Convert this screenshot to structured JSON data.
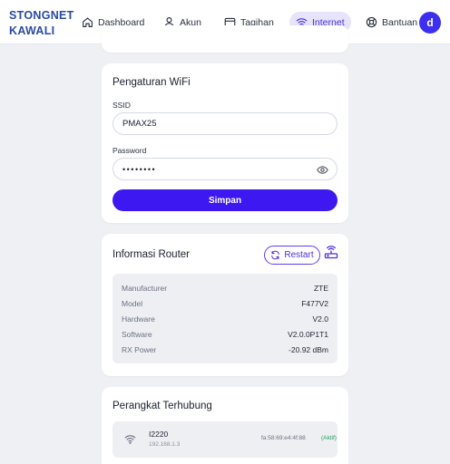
{
  "brand": {
    "line1": "STONGNET",
    "line2": "KAWALI"
  },
  "nav": [
    {
      "label": "Dashboard",
      "icon": "home-icon"
    },
    {
      "label": "Akun",
      "icon": "user-icon"
    },
    {
      "label": "Tagihan",
      "icon": "card-icon"
    },
    {
      "label": "Internet",
      "icon": "wifi-icon",
      "active": true
    },
    {
      "label": "Bantuan",
      "icon": "lifebuoy-icon"
    }
  ],
  "user": {
    "avatar_letter": "d"
  },
  "wifi_settings": {
    "title": "Pengaturan WiFi",
    "ssid_label": "SSID",
    "ssid_value": "PMAX25",
    "password_label": "Password",
    "password_masked": "••••••••",
    "save_label": "Simpan"
  },
  "router_info": {
    "title": "Informasi Router",
    "restart_label": "Restart",
    "rows": [
      {
        "key": "Manufacturer",
        "value": "ZTE"
      },
      {
        "key": "Model",
        "value": "F477V2"
      },
      {
        "key": "Hardware",
        "value": "V2.0"
      },
      {
        "key": "Software",
        "value": "V2.0.0P1T1"
      },
      {
        "key": "RX Power",
        "value": "-20.92 dBm"
      }
    ]
  },
  "connected_devices": {
    "title": "Perangkat Terhubung",
    "devices": [
      {
        "name": "I2220",
        "ip": "192.168.1.3",
        "mac": "fa:58:69:e4:4f:88",
        "status": "(Aktif)"
      }
    ]
  },
  "colors": {
    "accent": "#3d18f0",
    "brand": "#2a4aa0",
    "active_status": "#1ea35a"
  }
}
